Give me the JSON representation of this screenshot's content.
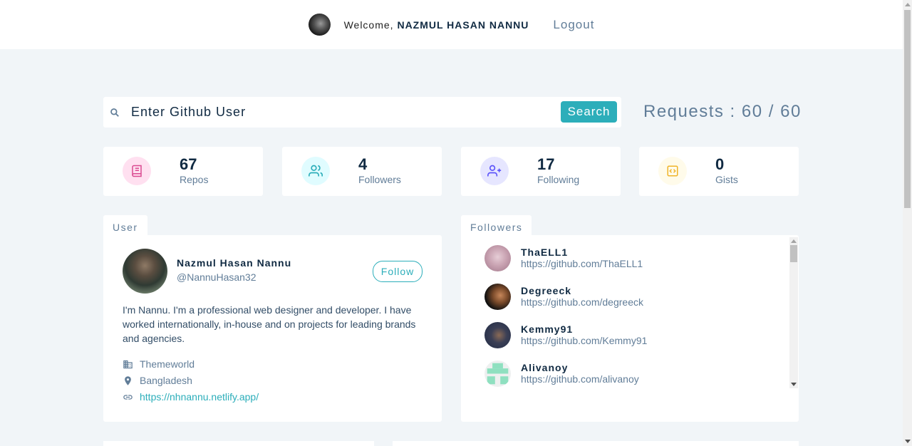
{
  "navbar": {
    "welcome_text": "Welcome,",
    "user_name": "NAZMUL HASAN NANNU",
    "logout_label": "Logout"
  },
  "search": {
    "placeholder": "Enter Github User",
    "button_label": "Search",
    "requests_text": "Requests : 60 / 60"
  },
  "stats": [
    {
      "value": "67",
      "label": "Repos",
      "icon": "book-icon",
      "color": "#da4a91",
      "bg": "#ffe0f0"
    },
    {
      "value": "4",
      "label": "Followers",
      "icon": "users-icon",
      "color": "#2caeba",
      "bg": "#e0fcff"
    },
    {
      "value": "17",
      "label": "Following",
      "icon": "user-plus-icon",
      "color": "#5d55fa",
      "bg": "#e6e6ff"
    },
    {
      "value": "0",
      "label": "Gists",
      "icon": "code-icon",
      "color": "#f0b429",
      "bg": "#fffbea"
    }
  ],
  "user_card": {
    "tab_label": "User",
    "name": "Nazmul Hasan Nannu",
    "handle": "@NannuHasan32",
    "follow_label": "Follow",
    "bio": "I'm Nannu. I'm a professional web designer and developer. I have worked internationally, in-house and on projects for leading brands and agencies.",
    "company": "Themeworld",
    "location": "Bangladesh",
    "blog": "https://nhnannu.netlify.app/"
  },
  "followers_card": {
    "tab_label": "Followers",
    "items": [
      {
        "name": "ThaELL1",
        "url": "https://github.com/ThaELL1"
      },
      {
        "name": "Degreeck",
        "url": "https://github.com/degreeck"
      },
      {
        "name": "Kemmy91",
        "url": "https://github.com/Kemmy91"
      },
      {
        "name": "Alivanoy",
        "url": "https://github.com/alivanoy"
      }
    ]
  }
}
